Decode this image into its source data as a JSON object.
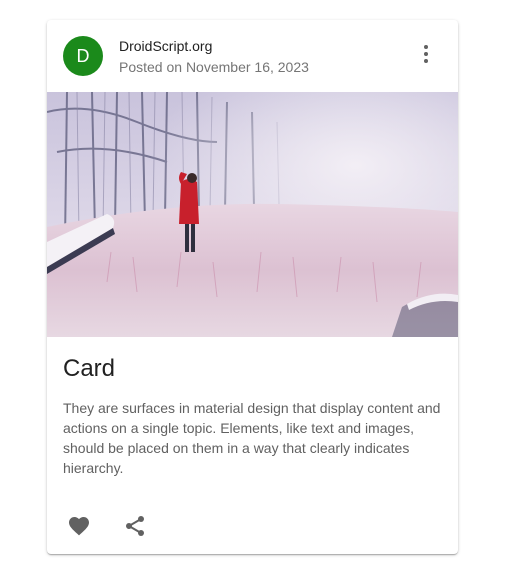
{
  "header": {
    "avatar_letter": "D",
    "title": "DroidScript.org",
    "subheader": "Posted on November 16, 2023"
  },
  "content": {
    "title": "Card",
    "body": "They are surfaces in material design that display content and actions on a single topic. Elements, like text and images, should be placed on them in a way that clearly indicates hierarchy."
  },
  "icons": {
    "more": "more-vert-icon",
    "favorite": "heart-icon",
    "share": "share-icon"
  },
  "colors": {
    "avatar": "#1b8a1b",
    "icon": "#616161"
  }
}
